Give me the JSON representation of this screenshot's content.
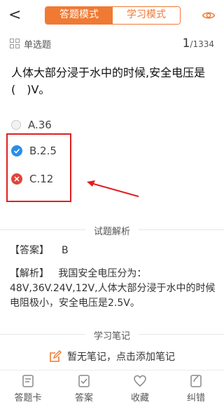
{
  "header": {
    "back_glyph": "<",
    "mode_answer": "答题模式",
    "mode_study": "学习模式"
  },
  "meta": {
    "question_type": "单选题",
    "current": "1",
    "total": "/1334"
  },
  "question": {
    "text": "人体大部分浸于水中的时候,安全电压是(　)V。",
    "options": [
      {
        "label": "A.36",
        "state": "none"
      },
      {
        "label": "B.2.5",
        "state": "correct"
      },
      {
        "label": "C.12",
        "state": "wrong"
      }
    ]
  },
  "analysis_section": {
    "title": "试题解析",
    "answer_label": "【答案】",
    "answer_value": "B",
    "explain_label": "【解析】",
    "explain_text": "我国安全电压分为：48V,36V.24V,12V,人体大部分浸于水中的时候电阻极小，安全电压是2.5V。"
  },
  "notes_section": {
    "title": "学习笔记",
    "empty_text": "暂无笔记，点击添加笔记"
  },
  "tabbar": {
    "items": [
      {
        "label": "答题卡",
        "icon": "answer-card-icon"
      },
      {
        "label": "答案",
        "icon": "answer-icon"
      },
      {
        "label": "收藏",
        "icon": "heart-icon"
      },
      {
        "label": "纠错",
        "icon": "error-report-icon"
      }
    ]
  },
  "colors": {
    "accent": "#f07a33",
    "correct": "#2a8ee8",
    "wrong": "#e0453c",
    "highlight": "#e02020"
  }
}
